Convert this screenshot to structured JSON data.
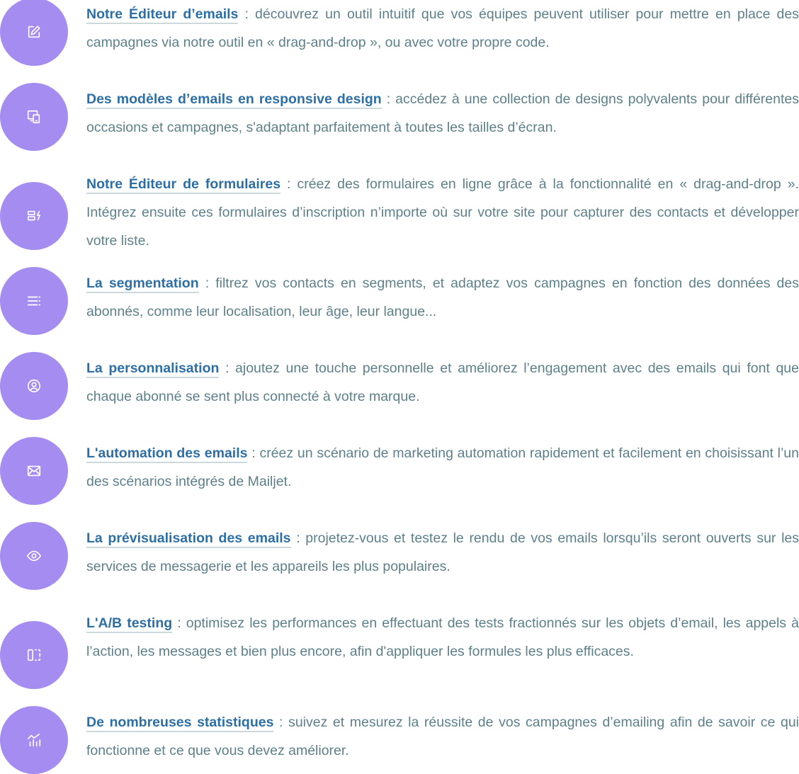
{
  "accent_color": "#a58cf1",
  "title_color": "#2c6fa6",
  "text_color": "#5d8089",
  "features": [
    {
      "icon": "edit-icon",
      "title": "Notre Éditeur d’emails",
      "description": " : découvrez un outil intuitif que vos équipes peuvent utiliser pour mettre en place des campagnes via notre outil en « drag-and-drop », ou avec votre propre code."
    },
    {
      "icon": "responsive-devices-icon",
      "title": "Des modèles d’emails en responsive design",
      "description": " : accédez à une collection de designs polyvalents pour différentes occasions et campagnes, s'adaptant parfaitement à toutes les tailles d’écran."
    },
    {
      "icon": "form-icon",
      "title": "Notre Éditeur de formulaires",
      "description": " : créez des formulaires en ligne grâce à la fonctionnalité en « drag-and-drop ». Intégrez ensuite ces formulaires d’inscription n’importe où sur votre site pour capturer des contacts et développer votre liste."
    },
    {
      "icon": "segment-list-icon",
      "title": "La segmentation",
      "description": " : filtrez vos contacts en segments, et adaptez vos campagnes en fonction des données des abonnés, comme leur localisation, leur âge, leur langue..."
    },
    {
      "icon": "user-circle-icon",
      "title": "La personnalisation",
      "description": " : ajoutez une touche personnelle et améliorez l’engagement avec des emails qui font que chaque abonné se sent plus connecté à votre marque."
    },
    {
      "icon": "envelope-icon",
      "title": "L'automation des emails",
      "description": " : créez un scénario de marketing automation rapidement et facilement en choisissant l’un des scénarios intégrés de Mailjet."
    },
    {
      "icon": "eye-icon",
      "title": "La prévisualisation des emails",
      "description": " : projetez-vous et testez le rendu de vos emails lorsqu’ils seront ouverts sur les services de messagerie et les appareils les plus populaires."
    },
    {
      "icon": "ab-split-icon",
      "title": "L'A/B testing",
      "description": " : optimisez les performances en effectuant des tests fractionnés sur les objets d’email, les appels à l’action, les messages et bien plus encore, afin d'appliquer les formules les plus efficaces."
    },
    {
      "icon": "stats-chart-icon",
      "title": "De nombreuses statistiques",
      "description": " : suivez et mesurez la réussite de vos campagnes d’emailing afin de savoir ce qui fonctionne et ce que vous devez améliorer."
    }
  ]
}
